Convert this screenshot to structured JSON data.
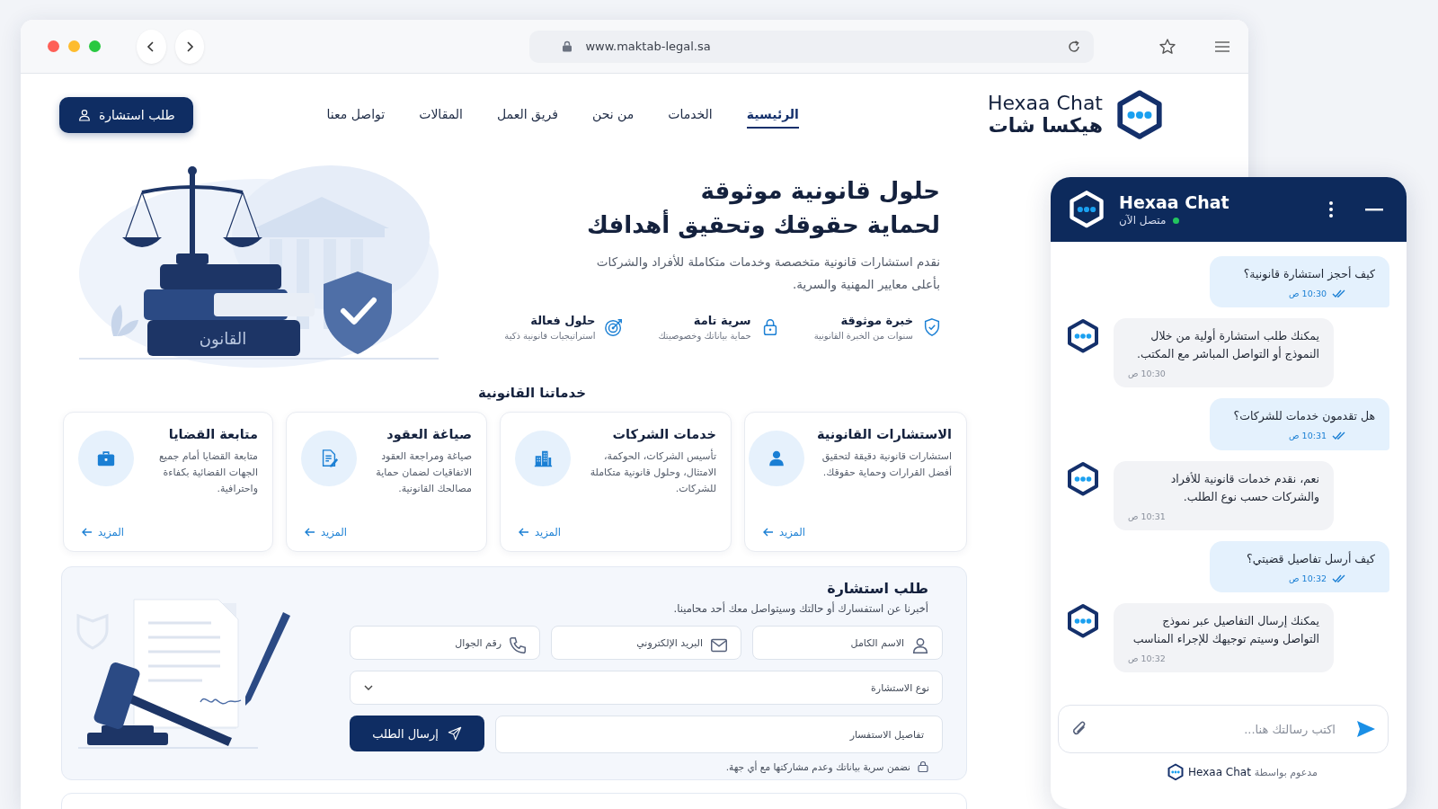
{
  "browser": {
    "url": "www.maktab-legal.sa"
  },
  "site": {
    "logo": {
      "latin": "Hexaa Chat",
      "arabic": "هيكسا شات"
    },
    "nav": [
      {
        "label": "الرئيسية",
        "selected": true
      },
      {
        "label": "الخدمات",
        "selected": false
      },
      {
        "label": "من نحن",
        "selected": false
      },
      {
        "label": "فريق العمل",
        "selected": false
      },
      {
        "label": "المقالات",
        "selected": false
      },
      {
        "label": "تواصل معنا",
        "selected": false
      }
    ],
    "cta_button": "طلب استشارة"
  },
  "hero": {
    "title_lines": [
      "حلول قانونية موثوقة",
      "لحماية حقوقك وتحقيق أهدافك"
    ],
    "description": "نقدم استشارات قانونية متخصصة وخدمات متكاملة للأفراد والشركات بأعلى معايير المهنية والسرية.",
    "illustration_label": "القانون",
    "features": [
      {
        "kind": "shield",
        "title": "خبرة موثوقة",
        "subtitle": "سنوات من الخبرة القانونية"
      },
      {
        "kind": "lock",
        "title": "سرية تامة",
        "subtitle": "حماية بياناتك وخصوصيتك"
      },
      {
        "kind": "target",
        "title": "حلول فعالة",
        "subtitle": "استراتيجيات قانونية ذكية"
      }
    ]
  },
  "services": {
    "heading": "خدماتنا القانونية",
    "cards": [
      {
        "kind": "person",
        "title": "الاستشارات القانونية",
        "description": "استشارات قانونية دقيقة لتحقيق أفضل القرارات وحماية حقوقك.",
        "link": "المزيد"
      },
      {
        "kind": "building",
        "title": "خدمات الشركات",
        "description": "تأسيس الشركات، الحوكمة، الامتثال، وحلول قانونية متكاملة للشركات.",
        "link": "المزيد"
      },
      {
        "kind": "document",
        "title": "صياغة العقود",
        "description": "صياغة ومراجعة العقود الاتفاقيات لضمان حماية مصالحك القانونية.",
        "link": "المزيد"
      },
      {
        "kind": "briefcase",
        "title": "متابعة القضايا",
        "description": "متابعة القضايا أمام جميع الجهات القضائية بكفاءة واحترافية.",
        "link": "المزيد"
      }
    ]
  },
  "consultation_form": {
    "title": "طلب استشارة",
    "subtitle": "أخبرنا عن استفسارك أو حالتك وسيتواصل معك أحد محامينا.",
    "fields": [
      {
        "kind": "user",
        "placeholder": "الاسم الكامل"
      },
      {
        "kind": "mail",
        "placeholder": "البريد الإلكتروني"
      },
      {
        "kind": "phone",
        "placeholder": "رقم الجوال"
      }
    ],
    "type_select": {
      "placeholder": "نوع الاستشارة"
    },
    "details": {
      "placeholder": "تفاصيل الاستفسار"
    },
    "submit": "إرسال الطلب",
    "privacy_note": "نضمن سرية بياناتك وعدم مشاركتها مع أي جهة."
  },
  "chat": {
    "title": "Hexaa Chat",
    "status": "متصل الآن",
    "online": true,
    "messages": [
      {
        "kind": "user",
        "text": "كيف أحجز استشارة قانونية؟",
        "time": "10:30 ص",
        "read": true
      },
      {
        "kind": "bot",
        "text": "يمكنك طلب استشارة أولية من خلال النموذج أو التواصل المباشر مع المكتب.",
        "time": "10:30 ص",
        "read": false
      },
      {
        "kind": "user",
        "text": "هل تقدمون خدمات للشركات؟",
        "time": "10:31 ص",
        "read": true
      },
      {
        "kind": "bot",
        "text": "نعم، نقدم خدمات قانونية للأفراد والشركات حسب نوع الطلب.",
        "time": "10:31 ص",
        "read": false
      },
      {
        "kind": "user",
        "text": "كيف أرسل تفاصيل قضيتي؟",
        "time": "10:32 ص",
        "read": true
      },
      {
        "kind": "bot",
        "text": "يمكنك إرسال التفاصيل عبر نموذج التواصل وسيتم توجيهك للإجراء المناسب",
        "time": "10:32 ص",
        "read": false
      }
    ],
    "input": {
      "placeholder": "اكتب رسالتك هنا..."
    },
    "footer": {
      "prefix": "مدعوم بواسطة",
      "brand": "Hexaa Chat"
    }
  }
}
